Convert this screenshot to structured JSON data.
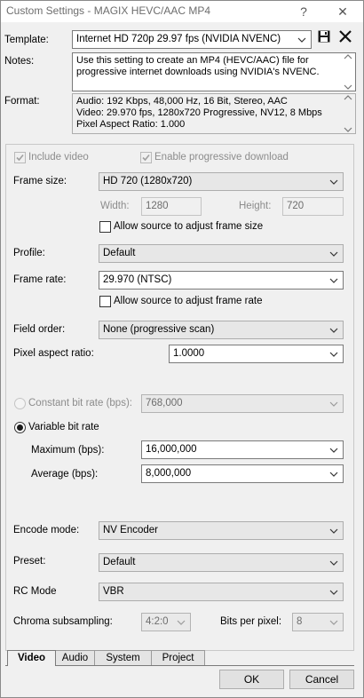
{
  "window": {
    "title": "Custom Settings - MAGIX HEVC/AAC MP4",
    "help_glyph": "?",
    "close_glyph": "✕"
  },
  "template": {
    "label": "Template:",
    "value": "Internet HD 720p 29.97 fps (NVIDIA NVENC)"
  },
  "notes": {
    "label": "Notes:",
    "lines": [
      "Use this setting to create an MP4 (HEVC/AAC) file for",
      "progressive internet downloads using NVIDIA's NVENC."
    ]
  },
  "format": {
    "label": "Format:",
    "lines": [
      "Audio: 192 Kbps, 48,000 Hz, 16 Bit, Stereo, AAC",
      "Video: 29.970 fps, 1280x720 Progressive, NV12, 8 Mbps",
      "Pixel Aspect Ratio: 1.000"
    ]
  },
  "video": {
    "include_video": "Include video",
    "enable_progressive": "Enable progressive download",
    "frame_size": {
      "label": "Frame size:",
      "value": "HD 720 (1280x720)"
    },
    "width": {
      "label": "Width:",
      "value": "1280"
    },
    "height": {
      "label": "Height:",
      "value": "720"
    },
    "allow_frame_size": "Allow source to adjust frame size",
    "profile": {
      "label": "Profile:",
      "value": "Default"
    },
    "frame_rate": {
      "label": "Frame rate:",
      "value": "29.970 (NTSC)"
    },
    "allow_frame_rate": "Allow source to adjust frame rate",
    "field_order": {
      "label": "Field order:",
      "value": "None (progressive scan)"
    },
    "pixel_aspect": {
      "label": "Pixel aspect ratio:",
      "value": "1.0000"
    },
    "cbr": {
      "label": "Constant bit rate (bps):",
      "value": "768,000"
    },
    "vbr": {
      "label": "Variable bit rate"
    },
    "maximum": {
      "label": "Maximum (bps):",
      "value": "16,000,000"
    },
    "average": {
      "label": "Average (bps):",
      "value": "8,000,000"
    },
    "encode_mode": {
      "label": "Encode mode:",
      "value": "NV Encoder"
    },
    "preset": {
      "label": "Preset:",
      "value": "Default"
    },
    "rc_mode": {
      "label": "RC Mode",
      "value": "VBR"
    },
    "chroma": {
      "label": "Chroma subsampling:",
      "value": "4:2:0"
    },
    "bits_per_pixel": {
      "label": "Bits per pixel:",
      "value": "8"
    }
  },
  "tabs": [
    "Video",
    "Audio",
    "System",
    "Project"
  ],
  "buttons": {
    "ok": "OK",
    "cancel": "Cancel"
  }
}
